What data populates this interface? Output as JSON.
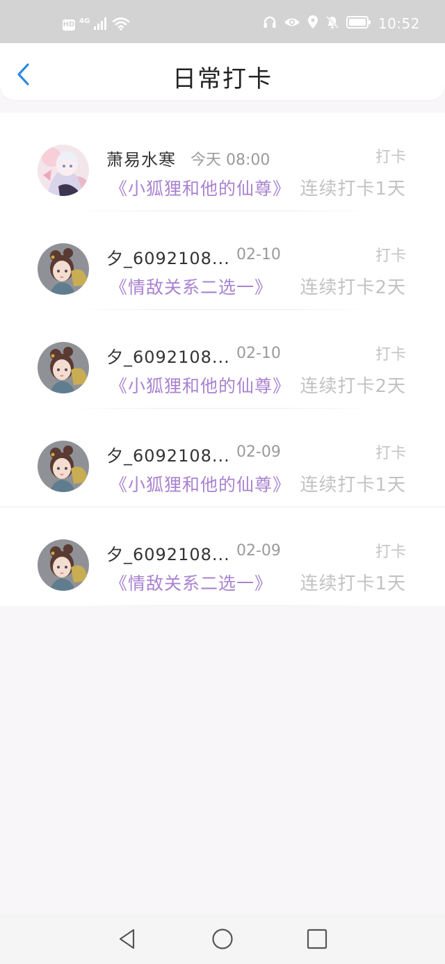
{
  "status_bar": {
    "hd_label": "HD",
    "network_label": "4G",
    "time": "10:52",
    "left_icons": [
      "signal-icon",
      "wifi-icon"
    ],
    "right_icons": [
      "headphones-icon",
      "eye-icon",
      "location-icon",
      "bell-off-icon",
      "battery-icon"
    ]
  },
  "header": {
    "title": "日常打卡",
    "back_icon": "chevron-left-icon",
    "accent_color": "#2a8ae0"
  },
  "colors": {
    "book_title": "#a982d0",
    "muted_text": "#c2c2c2",
    "page_bg": "#f8f6f8"
  },
  "entries": [
    {
      "avatar": "anime-avatar-white-hair",
      "name": "萧易水寒",
      "date": "今天 08:00",
      "action": "打卡",
      "book": "《小狐狸和他的仙尊》",
      "streak": "连续打卡1天"
    },
    {
      "avatar": "anime-avatar-girl-fan",
      "name": "夕_6092108...",
      "date": "02-10",
      "action": "打卡",
      "book": "《情敌关系二选一》",
      "streak": "连续打卡2天"
    },
    {
      "avatar": "anime-avatar-girl-fan",
      "name": "夕_6092108...",
      "date": "02-10",
      "action": "打卡",
      "book": "《小狐狸和他的仙尊》",
      "streak": "连续打卡2天"
    },
    {
      "avatar": "anime-avatar-girl-fan",
      "name": "夕_6092108...",
      "date": "02-09",
      "action": "打卡",
      "book": "《小狐狸和他的仙尊》",
      "streak": "连续打卡1天"
    },
    {
      "avatar": "anime-avatar-girl-fan",
      "name": "夕_6092108...",
      "date": "02-09",
      "action": "打卡",
      "book": "《情敌关系二选一》",
      "streak": "连续打卡1天"
    }
  ],
  "nav_bar": {
    "buttons": [
      "back-triangle-icon",
      "home-circle-icon",
      "recents-square-icon"
    ]
  }
}
